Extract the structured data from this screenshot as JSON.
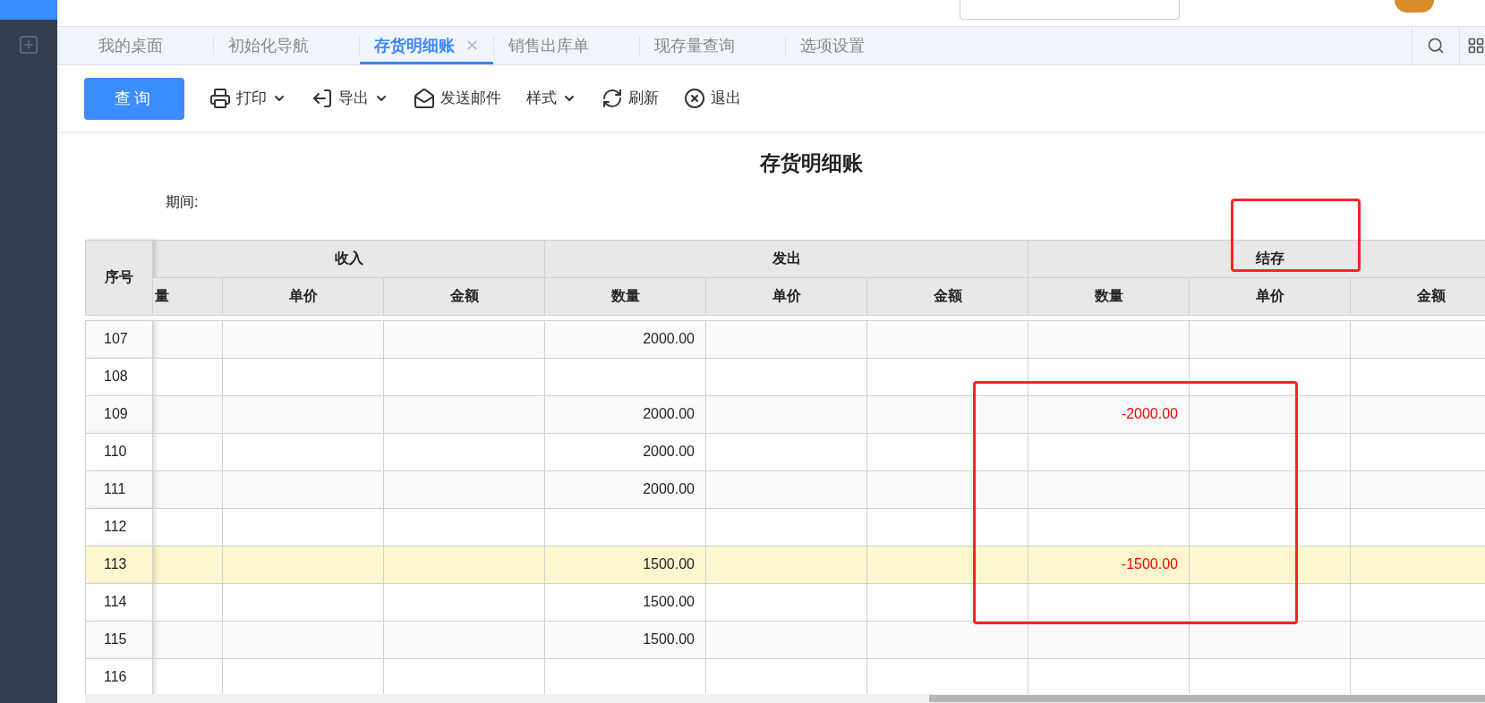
{
  "tabs": [
    {
      "label": "我的桌面",
      "selected": false,
      "closable": false
    },
    {
      "label": "初始化导航",
      "selected": false,
      "closable": false
    },
    {
      "label": "存货明细账",
      "selected": true,
      "closable": true,
      "close": "✕"
    },
    {
      "label": "销售出库单",
      "selected": false,
      "closable": false
    },
    {
      "label": "现存量查询",
      "selected": false,
      "closable": false
    },
    {
      "label": "选项设置",
      "selected": false,
      "closable": false
    }
  ],
  "toolbar": {
    "query_button": "查询",
    "items": [
      {
        "kind": "print",
        "label": "打印",
        "dropdown": true
      },
      {
        "kind": "export",
        "label": "导出",
        "dropdown": true
      },
      {
        "kind": "mail",
        "label": "发送邮件",
        "dropdown": false
      },
      {
        "kind": "style",
        "label": "样式",
        "dropdown": true
      },
      {
        "kind": "refresh",
        "label": "刷新",
        "dropdown": false
      },
      {
        "kind": "exit",
        "label": "退出",
        "dropdown": false
      }
    ]
  },
  "report": {
    "title": "存货明细账",
    "period_label": "期间:"
  },
  "table": {
    "index_header": "序号",
    "groups": [
      {
        "label": "收入",
        "columns": [
          "量",
          "单价",
          "金额"
        ]
      },
      {
        "label": "发出",
        "columns": [
          "数量",
          "单价",
          "金额"
        ]
      },
      {
        "label": "结存",
        "columns": [
          "数量",
          "单价",
          "金额"
        ]
      }
    ],
    "rows": [
      {
        "no": "107",
        "out_qty": "2000.00",
        "bal_qty": "",
        "selected": false
      },
      {
        "no": "108",
        "out_qty": "",
        "bal_qty": "",
        "selected": false
      },
      {
        "no": "109",
        "out_qty": "2000.00",
        "bal_qty": "-2000.00",
        "selected": false
      },
      {
        "no": "110",
        "out_qty": "2000.00",
        "bal_qty": "",
        "selected": false
      },
      {
        "no": "111",
        "out_qty": "2000.00",
        "bal_qty": "",
        "selected": false
      },
      {
        "no": "112",
        "out_qty": "",
        "bal_qty": "",
        "selected": false
      },
      {
        "no": "113",
        "out_qty": "1500.00",
        "bal_qty": "-1500.00",
        "selected": true
      },
      {
        "no": "114",
        "out_qty": "1500.00",
        "bal_qty": "",
        "selected": false
      },
      {
        "no": "115",
        "out_qty": "1500.00",
        "bal_qty": "",
        "selected": false
      },
      {
        "no": "116",
        "out_qty": "",
        "bal_qty": "",
        "selected": false
      }
    ]
  }
}
